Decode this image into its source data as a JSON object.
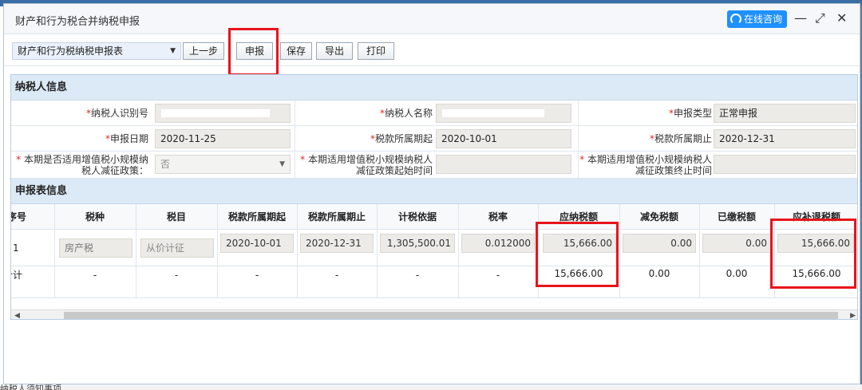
{
  "dialog": {
    "title": "财产和行为税合并纳税申报",
    "consult_label": "在线咨询",
    "minimize_glyph": "—",
    "maximize_glyph": "⤢",
    "close_glyph": "✕"
  },
  "toolbar": {
    "form_select": "财产和行为税纳税申报表",
    "prev_label": "上一步",
    "submit_label": "申报",
    "save_label": "保存",
    "export_label": "导出",
    "print_label": "打印"
  },
  "taxpayer": {
    "section_title": "纳税人信息",
    "id_label": "纳税人识别号",
    "name_label": "纳税人名称",
    "type_label": "申报类型",
    "type_value": "正常申报",
    "date_label": "申报日期",
    "date_value": "2020-11-25",
    "period_start_label": "税款所属期起",
    "period_start_value": "2020-10-01",
    "period_end_label": "税款所属期止",
    "period_end_value": "2020-12-31",
    "small_policy_label_1": "本期是否适用增值税小规模纳",
    "small_policy_label_2": "税人减征政策：",
    "small_policy_value": "否",
    "policy_start_label_1": "本期适用增值税小规模纳税人",
    "policy_start_label_2": "减征政策起始时间",
    "policy_end_label_1": "本期适用增值税小规模纳税人",
    "policy_end_label_2": "减征政策终止时间",
    "required_mark": "*"
  },
  "declaration": {
    "section_title": "申报表信息",
    "columns": [
      "序号",
      "税种",
      "税目",
      "税款所属期起",
      "税款所属期止",
      "计税依据",
      "税率",
      "应纳税额",
      "减免税额",
      "已缴税额",
      "应补退税额"
    ],
    "row": [
      "1",
      "房产税",
      "从价计征",
      "2020-10-01",
      "2020-12-31",
      "1,305,500.01",
      "0.012000",
      "15,666.00",
      "0.00",
      "0.00",
      "15,666.00"
    ],
    "total": [
      "合计",
      "-",
      "-",
      "-",
      "-",
      "-",
      "-",
      "15,666.00",
      "0.00",
      "0.00",
      "15,666.00"
    ]
  },
  "colors": {
    "highlight": "#e8141b",
    "section_bg": "#dceaf7",
    "consult_bg": "#1e90ff"
  },
  "background_text": "纳税人须知事项"
}
